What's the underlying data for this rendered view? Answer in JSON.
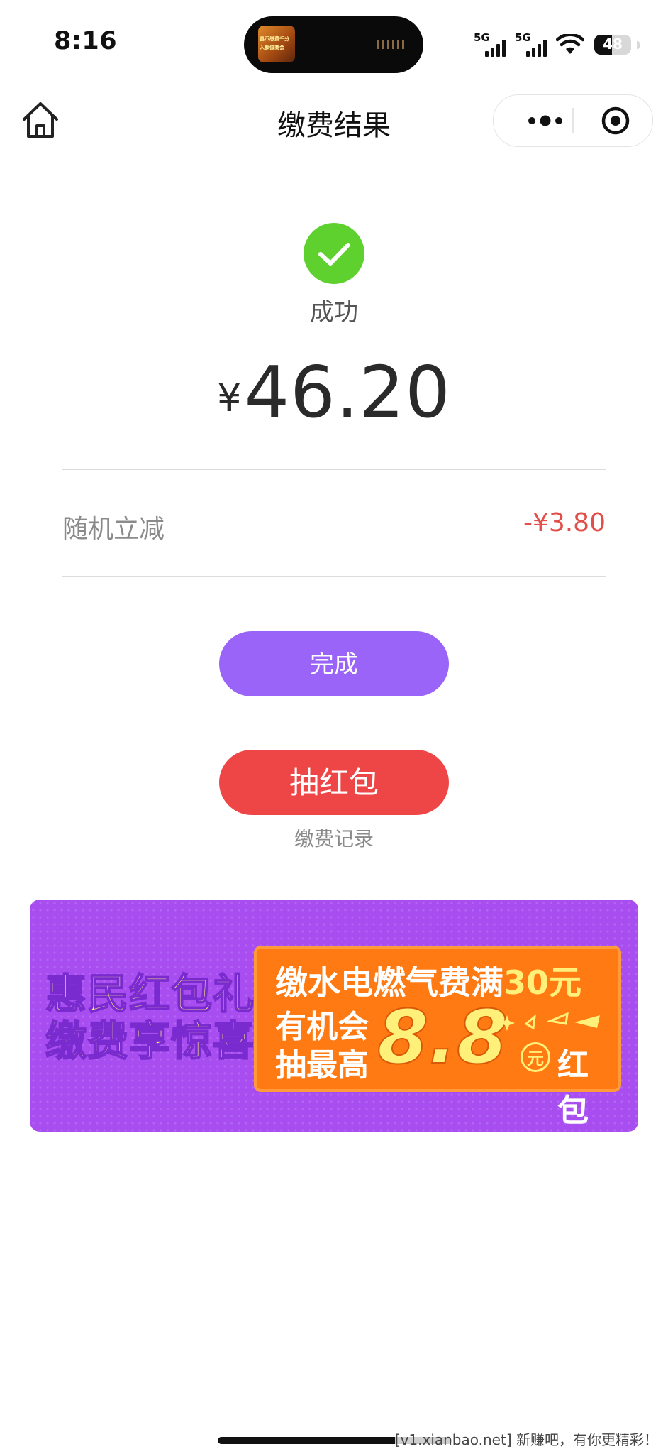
{
  "status_bar": {
    "time": "8:16",
    "island_thumb_text_1": "县币缴费千分",
    "island_thumb_text_2": "入额值商会",
    "network_1": "5G",
    "network_2": "5G",
    "battery": "48",
    "battery_level_percent": 48
  },
  "nav": {
    "title": "缴费结果",
    "home_icon": "home-icon",
    "more_icon": "more-dots-icon",
    "close_icon": "target-close-icon"
  },
  "result": {
    "status_text": "成功",
    "currency_symbol": "¥",
    "amount": "46.20",
    "discount_label": "随机立减",
    "discount_value": "-¥3.80",
    "status_color": "#5fd12f",
    "discount_color": "#e24e48"
  },
  "actions": {
    "done_label": "完成",
    "done_color": "#9a64f8",
    "red_packet_label": "抽红包",
    "red_packet_color": "#ee4646",
    "records_link": "缴费记录"
  },
  "banner": {
    "left_line_1": "惠民红包礼",
    "left_line_2": "缴费享惊喜",
    "card_line_1_prefix": "缴水电燃气费满",
    "card_line_1_highlight": "30元",
    "card_line_2": "有机会",
    "card_line_3": "抽最高",
    "big_amount": "8.8",
    "unit_badge": "元",
    "suffix": "红包"
  },
  "watermark": "[v1.xianbao.net] 新赚吧，有你更精彩！"
}
